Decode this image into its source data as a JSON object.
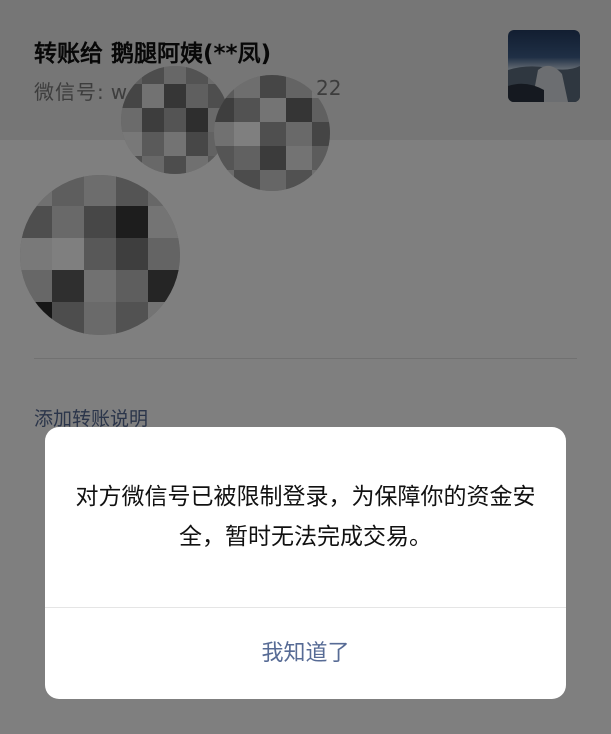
{
  "header": {
    "title_prefix": "转账给",
    "recipient_name": "鹅腿阿姨(**凤)",
    "wechat_id_label": "微信号:",
    "wechat_id_start": "w",
    "wechat_id_end": "22"
  },
  "content": {
    "add_note_link": "添加转账说明"
  },
  "dialog": {
    "message": "对方微信号已被限制登录，为保障你的资金安全，暂时无法完成交易。",
    "confirm_button": "我知道了"
  },
  "colors": {
    "link_blue": "#576b95",
    "mask": "rgba(0,0,0,0.5)",
    "dialog_bg": "#ffffff"
  },
  "icons": [
    "avatar-photo",
    "pixelation-mosaic"
  ]
}
